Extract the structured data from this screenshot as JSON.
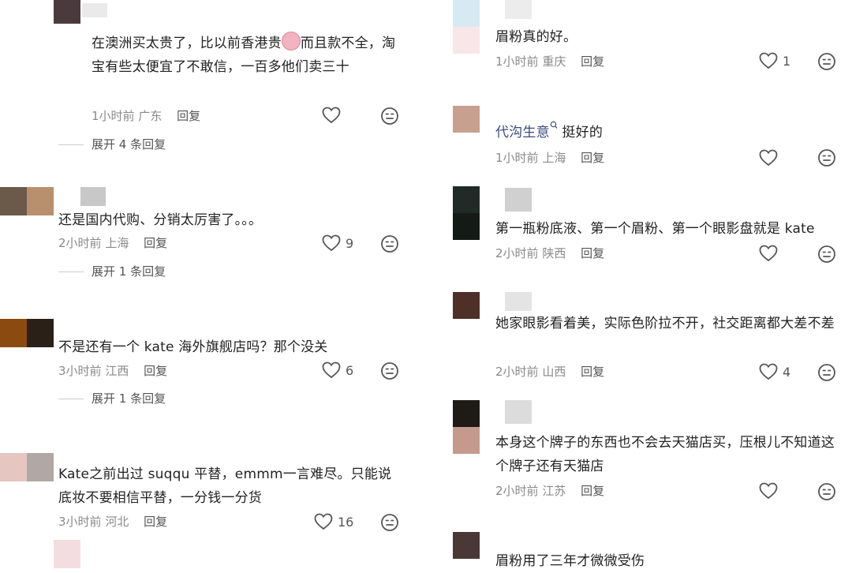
{
  "left_comments": [
    {
      "text_part1": "在澳洲买太贵了，比以前香港贵",
      "text_part2": "而且款不全，淘宝有些太便宜了不敢信，一百多他们卖三十",
      "time": "1小时前",
      "location": "广东",
      "reply": "回复",
      "likes": "",
      "expand": "展开 4 条回复"
    },
    {
      "text": "还是国内代购、分销太厉害了。。。",
      "time": "2小时前",
      "location": "上海",
      "reply": "回复",
      "likes": "9",
      "expand": "展开 1 条回复"
    },
    {
      "text": "不是还有一个 kate 海外旗舰店吗？那个没关",
      "time": "3小时前",
      "location": "江西",
      "reply": "回复",
      "likes": "6",
      "expand": "展开 1 条回复"
    },
    {
      "text": "Kate之前出过 suqqu 平替，emmm一言难尽。只能说底妆不要相信平替，一分钱一分货",
      "time": "3小时前",
      "location": "河北",
      "reply": "回复",
      "likes": "16"
    }
  ],
  "right_comments": [
    {
      "text": "眉粉真的好。",
      "time": "1小时前",
      "location": "重庆",
      "reply": "回复",
      "likes": "1"
    },
    {
      "link": "代沟生意",
      "text": "挺好的",
      "time": "1小时前",
      "location": "上海",
      "reply": "回复",
      "likes": ""
    },
    {
      "text": "第一瓶粉底液、第一个眉粉、第一个眼影盘就是 kate",
      "time": "2小时前",
      "location": "陕西",
      "reply": "回复",
      "likes": ""
    },
    {
      "text": "她家眼影看着美，实际色阶拉不开，社交距离都大差不差",
      "time": "2小时前",
      "location": "山西",
      "reply": "回复",
      "likes": "4"
    },
    {
      "text": "本身这个牌子的东西也不会去天猫店买，压根儿不知道这个牌子还有天猫店",
      "time": "2小时前",
      "location": "江苏",
      "reply": "回复",
      "likes": ""
    },
    {
      "text": "眉粉用了三年才微微受伤"
    }
  ],
  "colors": {
    "text": "#222222",
    "meta": "#8a8a8a",
    "link": "#3c4d7c",
    "icon": "#555555"
  },
  "icons": [
    "heart-icon",
    "dislike-face-icon",
    "search-link-icon"
  ]
}
